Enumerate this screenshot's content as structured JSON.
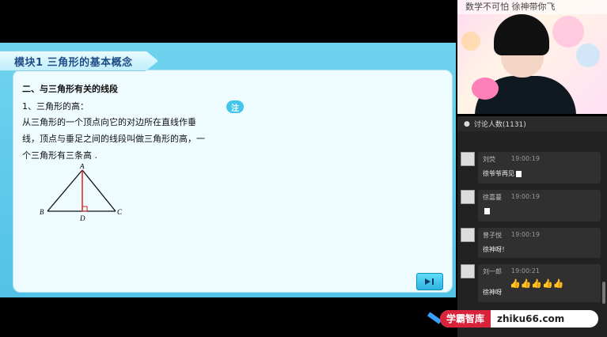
{
  "slide": {
    "module_title": "模块1  三角形的基本概念",
    "section_title": "二、与三角形有关的线段",
    "sub_title": "1、三角形的高：",
    "body": "从三角形的一个顶点向它的对边所在直线作垂线，顶点与垂足之间的线段叫做三角形的高，一个三角形有三条高 .",
    "note_badge": "注",
    "figure_labels": {
      "a": "A",
      "b": "B",
      "c": "C",
      "d": "D"
    }
  },
  "camera": {
    "banner": "数学不可怕  徐神带你飞"
  },
  "chat": {
    "header": "讨论人数(1131)",
    "messages": [
      {
        "name": "刘荧",
        "time": "19:00:19",
        "text": "徐爷爷再见"
      },
      {
        "name": "徐嘉蔓",
        "time": "19:00:19",
        "text": ""
      },
      {
        "name": "曾子悦",
        "time": "19:00:19",
        "text": "徐神呀！"
      },
      {
        "name": "刘一郎",
        "time": "19:00:21",
        "text": "徐神呀"
      }
    ]
  },
  "watermark": {
    "left": "学霸智库",
    "right": "zhiku66.com"
  },
  "colors": {
    "slide_bg": "#52c2e6",
    "accent": "#1d4c86",
    "triangle_altitude": "#e0201c"
  }
}
